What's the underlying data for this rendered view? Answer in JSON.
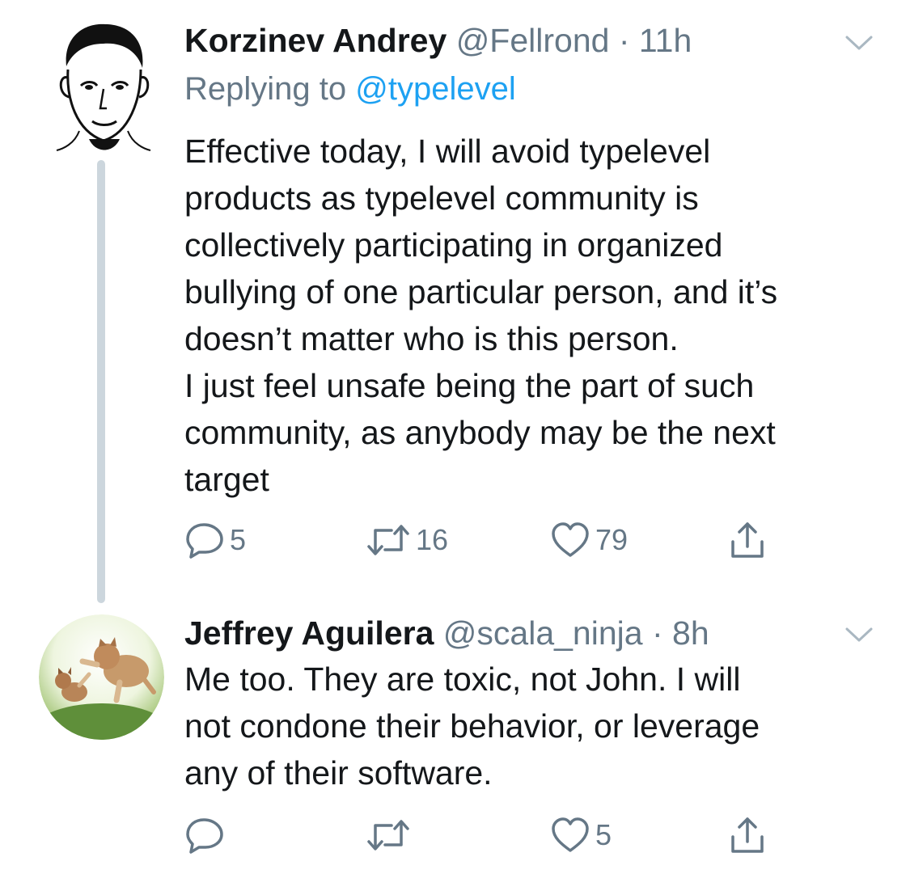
{
  "tweets": [
    {
      "name": "Korzinev Andrey",
      "handle": "@Fellrond",
      "separator": "·",
      "time": "11h",
      "replying_prefix": "Replying to",
      "replying_to": "@typelevel",
      "text_lines": [
        "Effective today, I will avoid typelevel",
        "products as typelevel community is",
        "collectively participating in organized",
        "bullying of one particular person, and it’s",
        "doesn’t matter who is this person.",
        "I just feel unsafe being the part of such",
        "community, as anybody may be the next",
        "target"
      ],
      "reply_count": "5",
      "retweet_count": "16",
      "like_count": "79"
    },
    {
      "name": "Jeffrey Aguilera",
      "handle": "@scala_ninja",
      "separator": "·",
      "time": "8h",
      "text_lines": [
        "Me too. They are toxic, not John. I will",
        "not condone their behavior, or leverage",
        "any of their software."
      ],
      "reply_count": "",
      "retweet_count": "",
      "like_count": "5"
    }
  ],
  "icons": {
    "reply": "reply-icon",
    "retweet": "retweet-icon",
    "like": "heart-icon",
    "share": "share-icon",
    "caret": "chevron-down-icon"
  },
  "colors": {
    "text": "#14171a",
    "secondary": "#657786",
    "link": "#1da1f2",
    "thread_line": "#ccd6dd"
  }
}
